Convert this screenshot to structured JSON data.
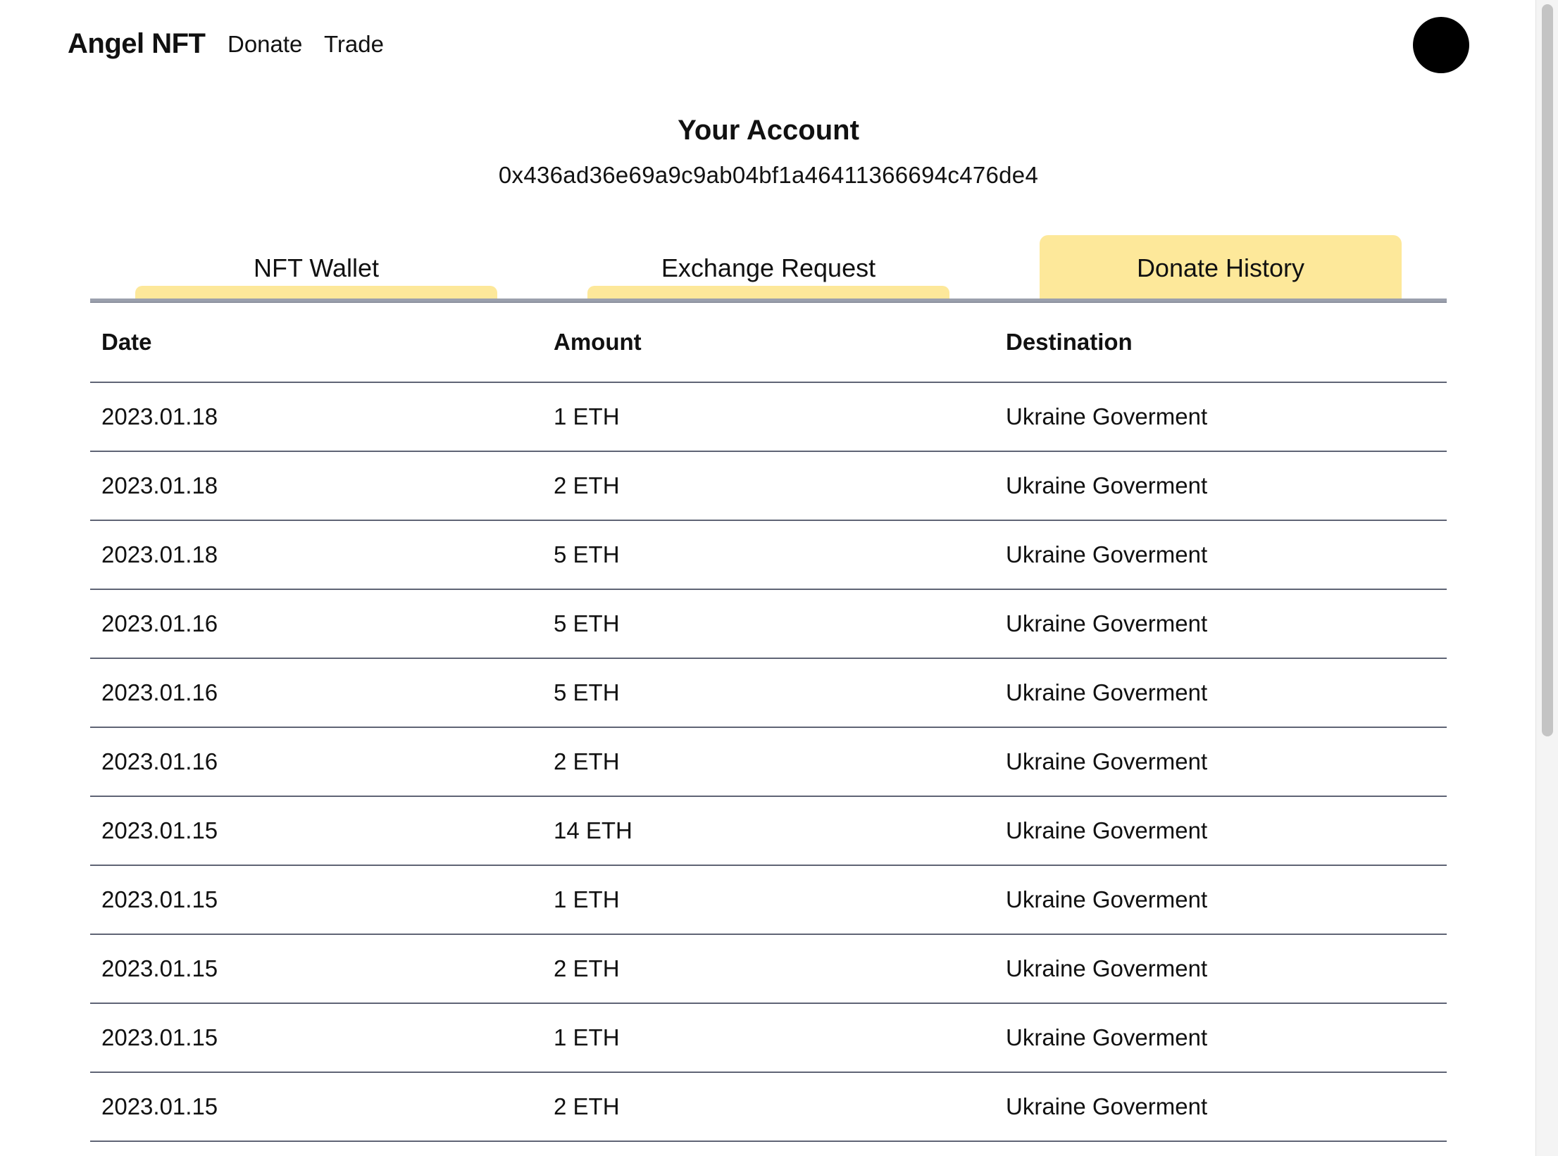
{
  "header": {
    "brand": "Angel NFT",
    "nav": [
      "Donate",
      "Trade"
    ]
  },
  "account": {
    "title": "Your Account",
    "address": "0x436ad36e69a9c9ab04bf1a46411366694c476de4"
  },
  "tabs": [
    {
      "label": "NFT Wallet",
      "active": false
    },
    {
      "label": "Exchange Request",
      "active": false
    },
    {
      "label": "Donate History",
      "active": true
    }
  ],
  "colors": {
    "accent": "#fde89a",
    "rule": "#5f6475",
    "avatar": "#000000"
  },
  "table": {
    "columns": [
      "Date",
      "Amount",
      "Destination"
    ],
    "rows": [
      {
        "date": "2023.01.18",
        "amount": "1 ETH",
        "destination": "Ukraine Goverment"
      },
      {
        "date": "2023.01.18",
        "amount": "2 ETH",
        "destination": "Ukraine Goverment"
      },
      {
        "date": "2023.01.18",
        "amount": "5 ETH",
        "destination": "Ukraine Goverment"
      },
      {
        "date": "2023.01.16",
        "amount": "5 ETH",
        "destination": "Ukraine Goverment"
      },
      {
        "date": "2023.01.16",
        "amount": "5 ETH",
        "destination": "Ukraine Goverment"
      },
      {
        "date": "2023.01.16",
        "amount": "2 ETH",
        "destination": "Ukraine Goverment"
      },
      {
        "date": "2023.01.15",
        "amount": "14 ETH",
        "destination": "Ukraine Goverment"
      },
      {
        "date": "2023.01.15",
        "amount": "1 ETH",
        "destination": "Ukraine Goverment"
      },
      {
        "date": "2023.01.15",
        "amount": "2 ETH",
        "destination": "Ukraine Goverment"
      },
      {
        "date": "2023.01.15",
        "amount": "1 ETH",
        "destination": "Ukraine Goverment"
      },
      {
        "date": "2023.01.15",
        "amount": "2 ETH",
        "destination": "Ukraine Goverment"
      }
    ]
  }
}
